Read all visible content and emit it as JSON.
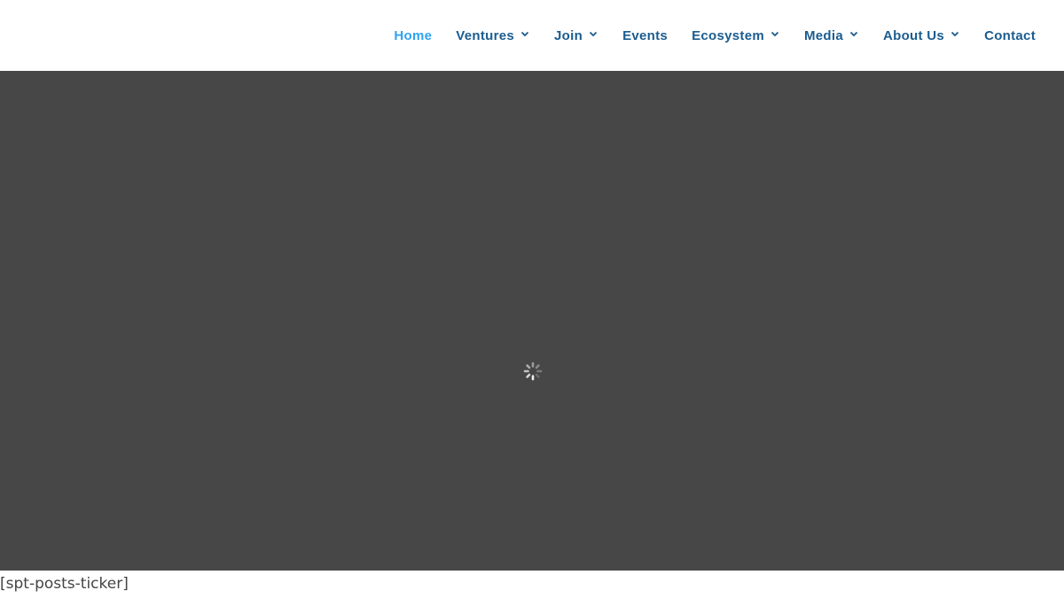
{
  "nav": {
    "items": [
      {
        "label": "Home",
        "active": true,
        "dropdown": false
      },
      {
        "label": "Ventures",
        "active": false,
        "dropdown": true
      },
      {
        "label": "Join",
        "active": false,
        "dropdown": true
      },
      {
        "label": "Events",
        "active": false,
        "dropdown": false
      },
      {
        "label": "Ecosystem",
        "active": false,
        "dropdown": true
      },
      {
        "label": "Media",
        "active": false,
        "dropdown": true
      },
      {
        "label": "About Us",
        "active": false,
        "dropdown": true
      },
      {
        "label": "Contact",
        "active": false,
        "dropdown": false
      }
    ]
  },
  "hero": {
    "loading_icon": "spinner-icon"
  },
  "ticker": {
    "shortcode": "[spt-posts-ticker]"
  },
  "colors": {
    "nav_text": "#1b5c8f",
    "nav_active": "#2ea3f2",
    "hero_bg": "#474747",
    "page_bg": "#ffffff"
  }
}
